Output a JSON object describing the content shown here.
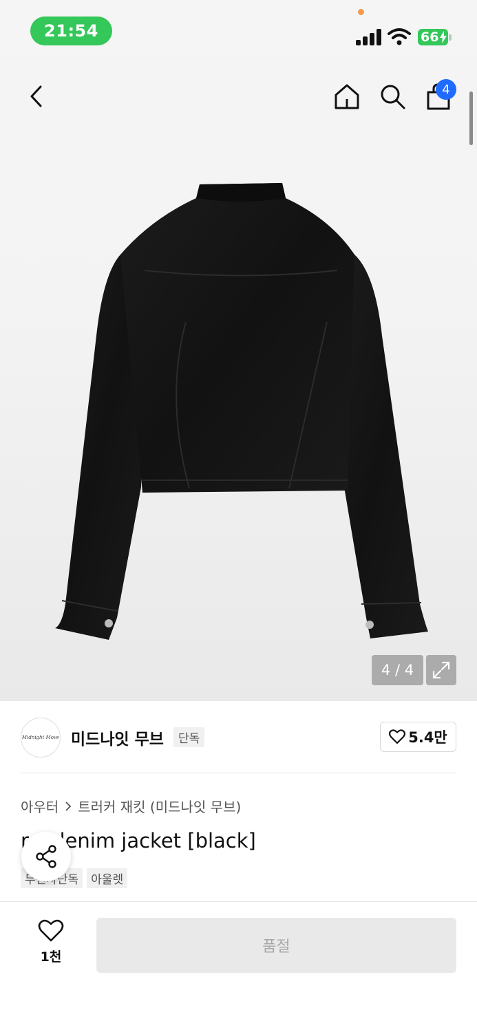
{
  "status_bar": {
    "time": "21:54",
    "battery": "66"
  },
  "nav": {
    "back_icon": "chevron-left-icon",
    "home_icon": "home-icon",
    "search_icon": "search-icon",
    "cart_icon": "shopping-bag-icon",
    "cart_badge": "4"
  },
  "gallery": {
    "counter": "4 / 4",
    "current_image": 4,
    "total_images": 4,
    "expand_icon": "expand-icon"
  },
  "brand": {
    "logo_text": "Midnight Move",
    "name": "미드나잇 무브",
    "tag": "단독",
    "like_count": "5.4만"
  },
  "product": {
    "breadcrumb": [
      "아우터",
      "트러커 재킷 (미드나잇 무브)"
    ],
    "title": "r... denim jacket [black]",
    "tags": [
      "무신사단독",
      "아울렛"
    ],
    "share_icon": "share-icon"
  },
  "bottom_bar": {
    "wish_count": "1천",
    "button_label": "품절"
  },
  "colors": {
    "accent": "#1f6bff",
    "status_green": "#34c759",
    "disabled_bg": "#e9e9e9",
    "disabled_text": "#a8a8a8"
  }
}
